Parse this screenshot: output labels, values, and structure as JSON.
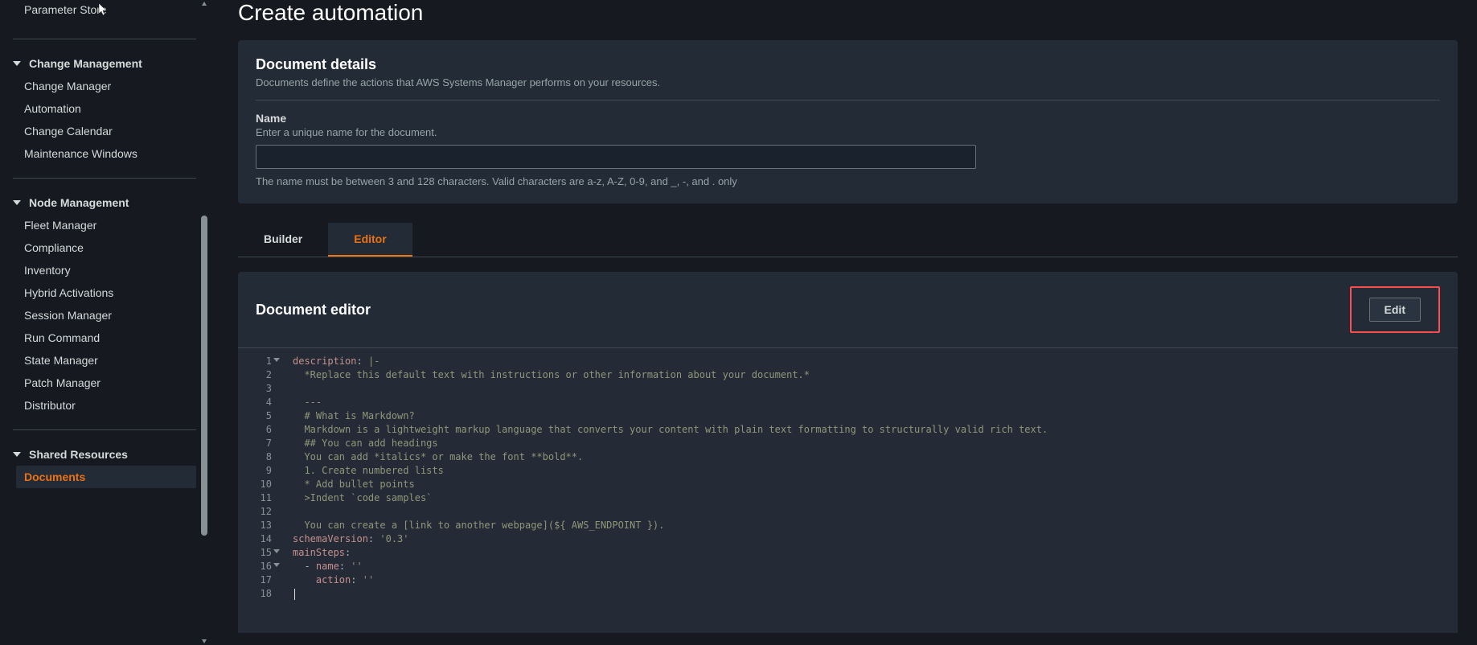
{
  "sidebar": {
    "top_item": "Parameter Store",
    "groups": [
      {
        "title": "Change Management",
        "items": [
          "Change Manager",
          "Automation",
          "Change Calendar",
          "Maintenance Windows"
        ]
      },
      {
        "title": "Node Management",
        "items": [
          "Fleet Manager",
          "Compliance",
          "Inventory",
          "Hybrid Activations",
          "Session Manager",
          "Run Command",
          "State Manager",
          "Patch Manager",
          "Distributor"
        ]
      },
      {
        "title": "Shared Resources",
        "items": [
          "Documents"
        ],
        "active_index": 0
      }
    ]
  },
  "page": {
    "title": "Create automation",
    "details": {
      "heading": "Document details",
      "subtitle": "Documents define the actions that AWS Systems Manager performs on your resources.",
      "name_label": "Name",
      "name_hint": "Enter a unique name for the document.",
      "name_value": "",
      "name_help": "The name must be between 3 and 128 characters. Valid characters are a-z, A-Z, 0-9, and _, -, and . only"
    },
    "tabs": {
      "builder": "Builder",
      "editor": "Editor",
      "active": "editor"
    },
    "editor": {
      "heading": "Document editor",
      "edit_button": "Edit"
    }
  },
  "code": {
    "lines": [
      {
        "n": 1,
        "fold": true,
        "tokens": [
          [
            "key",
            "description"
          ],
          [
            "op",
            ":"
          ],
          [
            "text",
            " |-"
          ]
        ]
      },
      {
        "n": 2,
        "tokens": [
          [
            "text",
            "  *Replace this default text with instructions or other information about your document.*"
          ]
        ]
      },
      {
        "n": 3,
        "tokens": [
          [
            "text",
            ""
          ]
        ]
      },
      {
        "n": 4,
        "tokens": [
          [
            "text",
            "  ---"
          ]
        ]
      },
      {
        "n": 5,
        "tokens": [
          [
            "text",
            "  # What is Markdown?"
          ]
        ]
      },
      {
        "n": 6,
        "tokens": [
          [
            "text",
            "  Markdown is a lightweight markup language that converts your content with plain text formatting to structurally valid rich text."
          ]
        ]
      },
      {
        "n": 7,
        "tokens": [
          [
            "text",
            "  ## You can add headings"
          ]
        ]
      },
      {
        "n": 8,
        "tokens": [
          [
            "text",
            "  You can add *italics* or make the font **bold**."
          ]
        ]
      },
      {
        "n": 9,
        "tokens": [
          [
            "text",
            "  1. Create numbered lists"
          ]
        ]
      },
      {
        "n": 10,
        "tokens": [
          [
            "text",
            "  * Add bullet points"
          ]
        ]
      },
      {
        "n": 11,
        "tokens": [
          [
            "text",
            "  >Indent `code samples`"
          ]
        ]
      },
      {
        "n": 12,
        "tokens": [
          [
            "text",
            ""
          ]
        ]
      },
      {
        "n": 13,
        "tokens": [
          [
            "text",
            "  You can create a [link to another webpage](${ AWS_ENDPOINT })."
          ]
        ]
      },
      {
        "n": 14,
        "tokens": [
          [
            "key",
            "schemaVersion"
          ],
          [
            "op",
            ": "
          ],
          [
            "str",
            "'0.3'"
          ]
        ]
      },
      {
        "n": 15,
        "fold": true,
        "tokens": [
          [
            "key",
            "mainSteps"
          ],
          [
            "op",
            ":"
          ]
        ]
      },
      {
        "n": 16,
        "fold": true,
        "tokens": [
          [
            "op",
            "  - "
          ],
          [
            "key",
            "name"
          ],
          [
            "op",
            ": "
          ],
          [
            "str",
            "''"
          ]
        ]
      },
      {
        "n": 17,
        "tokens": [
          [
            "op",
            "    "
          ],
          [
            "key",
            "action"
          ],
          [
            "op",
            ": "
          ],
          [
            "str",
            "''"
          ]
        ]
      },
      {
        "n": 18,
        "tokens": [
          [
            "text",
            ""
          ]
        ],
        "caret": true
      }
    ]
  }
}
